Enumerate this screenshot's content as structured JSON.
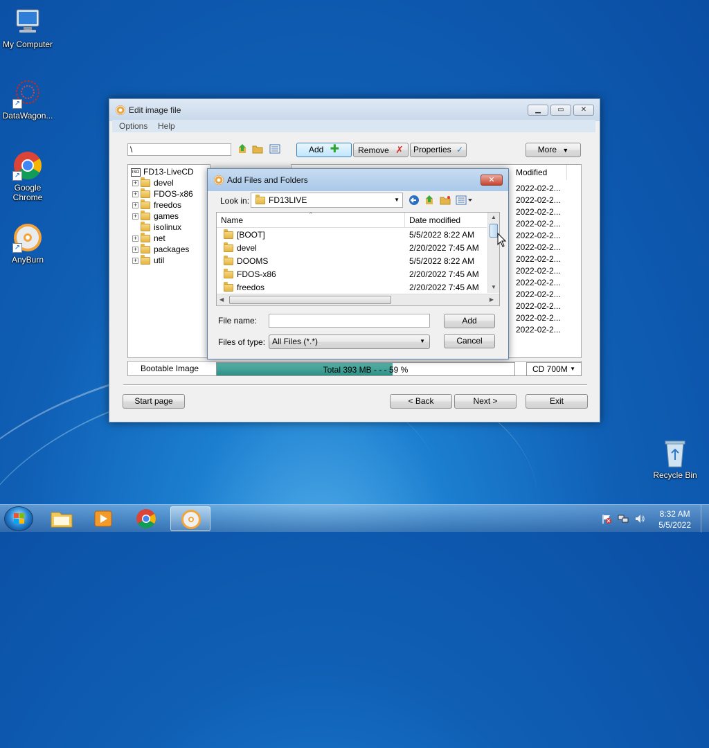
{
  "desktop": {
    "icons": [
      {
        "label": "My Computer"
      },
      {
        "label": "DataWagon..."
      },
      {
        "label": "Google Chrome"
      },
      {
        "label": "AnyBurn"
      },
      {
        "label": "Recycle Bin"
      }
    ]
  },
  "window": {
    "title": "Edit image file",
    "menu": [
      "Options",
      "Help"
    ],
    "path_value": "\\",
    "toolbar": {
      "add": "Add",
      "remove": "Remove",
      "properties": "Properties",
      "more": "More"
    },
    "tree": {
      "root": "FD13-LiveCD",
      "items": [
        "devel",
        "FDOS-x86",
        "freedos",
        "games",
        "isolinux",
        "net",
        "packages",
        "util"
      ]
    },
    "list": {
      "modified_header": "Modified",
      "modified_values": [
        "2022-02-2...",
        "2022-02-2...",
        "2022-02-2...",
        "2022-02-2...",
        "2022-02-2...",
        "2022-02-2...",
        "2022-02-2...",
        "2022-02-2...",
        "2022-02-2...",
        "2022-02-2...",
        "2022-02-2...",
        "2022-02-2...",
        "2022-02-2..."
      ]
    },
    "status": {
      "bootable": "Bootable Image",
      "total": "Total  393 MB   - - -  59 %",
      "progress_fraction": 0.59,
      "media": "CD 700M"
    },
    "footer": {
      "start_page": "Start page",
      "back": "< Back",
      "next": "Next >",
      "exit": "Exit"
    }
  },
  "dialog": {
    "title": "Add Files and Folders",
    "look_in_label": "Look in:",
    "look_in_value": "FD13LIVE",
    "columns": {
      "name": "Name",
      "date": "Date modified"
    },
    "rows": [
      {
        "name": "[BOOT]",
        "date": "5/5/2022 8:22 AM"
      },
      {
        "name": "devel",
        "date": "2/20/2022 7:45 AM"
      },
      {
        "name": "DOOMS",
        "date": "5/5/2022 8:22 AM"
      },
      {
        "name": "FDOS-x86",
        "date": "2/20/2022 7:45 AM"
      },
      {
        "name": "freedos",
        "date": "2/20/2022 7:45 AM"
      }
    ],
    "file_name_label": "File name:",
    "file_name_value": "",
    "file_type_label": "Files of type:",
    "file_type_value": "All Files (*.*)",
    "add_button": "Add",
    "cancel_button": "Cancel"
  },
  "taskbar": {
    "time": "8:32 AM",
    "date": "5/5/2022"
  }
}
